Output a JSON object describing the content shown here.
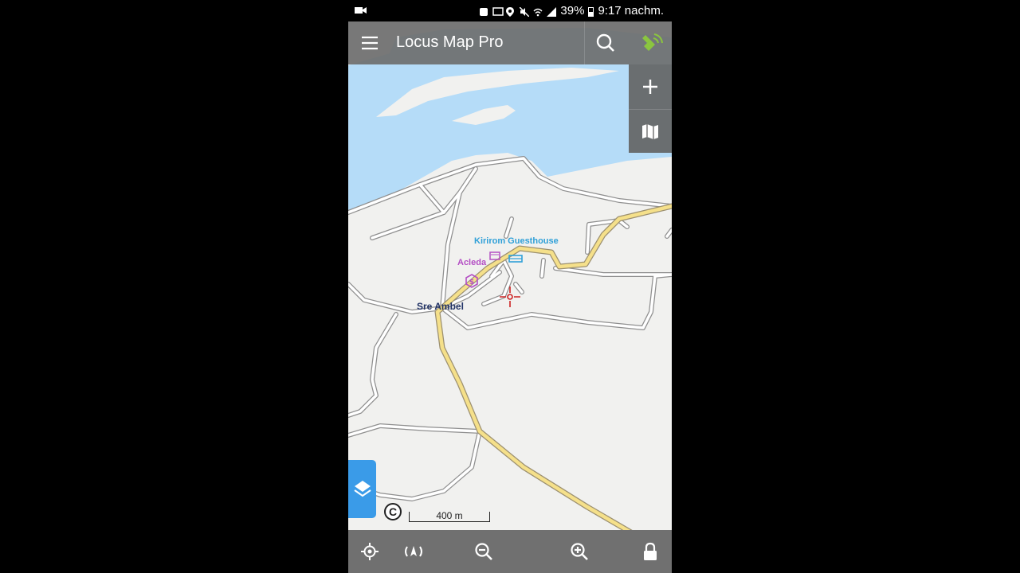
{
  "status_bar": {
    "battery": "39%",
    "time": "9:17 nachm."
  },
  "app": {
    "title": "Locus Map Pro"
  },
  "map": {
    "labels": {
      "guesthouse": "Kirirom Guesthouse",
      "bank": "Acleda",
      "town": "Sre Ambel"
    },
    "scale": "400 m",
    "copyright_symbol": "C"
  },
  "icons": {
    "menu": "hamburger-menu-icon",
    "search": "search-icon",
    "gps": "gps-satellite-icon",
    "add": "plus-icon",
    "maps": "map-manager-icon",
    "layers": "layers-icon",
    "my_location": "my-location-icon",
    "rotate": "map-rotate-icon",
    "zoom_out": "zoom-out-icon",
    "zoom_in": "zoom-in-icon",
    "lock": "lock-icon"
  },
  "colors": {
    "water": "#b5dcf8",
    "land": "#f1f1ef",
    "main_road": "#f5e08a",
    "bars": "#707070",
    "gps_green": "#8bc53f",
    "layers_blue": "#3a9be8",
    "guesthouse_label": "#2fa0d8",
    "bank_label": "#b44fc4",
    "town_label": "#223366",
    "crosshair": "#cc2222"
  }
}
